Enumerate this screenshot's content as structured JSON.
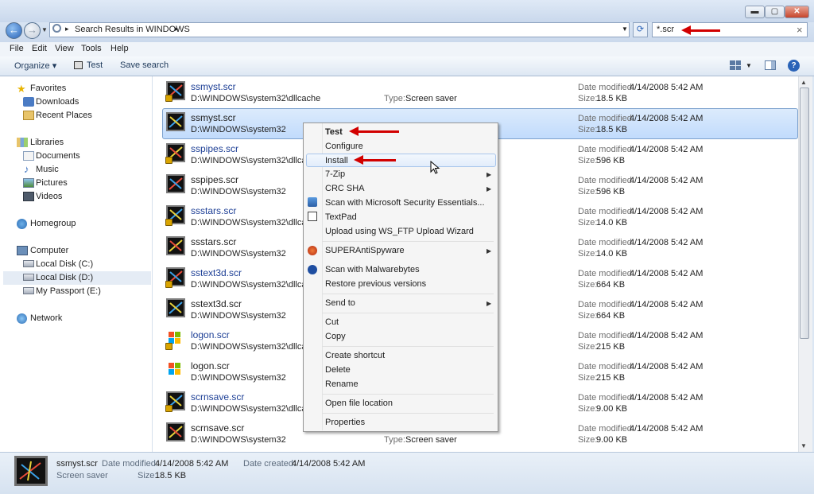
{
  "window": {
    "minimize": "▬",
    "maximize": "▢",
    "close": "✕"
  },
  "address": {
    "path_root": "▸",
    "search_results": "Search Results in WINDOWS",
    "path_sep": "▸"
  },
  "search": {
    "value": "*.scr",
    "clear": "×"
  },
  "menubar": {
    "file": "File",
    "edit": "Edit",
    "view": "View",
    "tools": "Tools",
    "help": "Help"
  },
  "toolbar": {
    "organize": "Organize ▾",
    "test": "Test",
    "save_search": "Save search"
  },
  "sidebar": {
    "favorites": "Favorites",
    "downloads": "Downloads",
    "recent_places": "Recent Places",
    "libraries": "Libraries",
    "documents": "Documents",
    "music": "Music",
    "pictures": "Pictures",
    "videos": "Videos",
    "homegroup": "Homegroup",
    "computer": "Computer",
    "local_c": "Local Disk (C:)",
    "local_d": "Local Disk (D:)",
    "passport": "My Passport (E:)",
    "network": "Network"
  },
  "labels": {
    "date_modified": "Date modified:",
    "size": "Size:",
    "type": "Type:"
  },
  "files": [
    {
      "name": "ssmyst.scr",
      "path": "D:\\WINDOWS\\system32\\dllcache",
      "date": "4/14/2008 5:42 AM",
      "size": "18.5 KB",
      "type": "Screen saver"
    },
    {
      "name": "ssmyst.scr",
      "path": "D:\\WINDOWS\\system32",
      "date": "4/14/2008 5:42 AM",
      "size": "18.5 KB"
    },
    {
      "name": "sspipes.scr",
      "path": "D:\\WINDOWS\\system32\\dllcache",
      "date": "4/14/2008 5:42 AM",
      "size": "596 KB"
    },
    {
      "name": "sspipes.scr",
      "path": "D:\\WINDOWS\\system32",
      "date": "4/14/2008 5:42 AM",
      "size": "596 KB"
    },
    {
      "name": "ssstars.scr",
      "path": "D:\\WINDOWS\\system32\\dllcache",
      "date": "4/14/2008 5:42 AM",
      "size": "14.0 KB"
    },
    {
      "name": "ssstars.scr",
      "path": "D:\\WINDOWS\\system32",
      "date": "4/14/2008 5:42 AM",
      "size": "14.0 KB"
    },
    {
      "name": "sstext3d.scr",
      "path": "D:\\WINDOWS\\system32\\dllcache",
      "date": "4/14/2008 5:42 AM",
      "size": "664 KB"
    },
    {
      "name": "sstext3d.scr",
      "path": "D:\\WINDOWS\\system32",
      "date": "4/14/2008 5:42 AM",
      "size": "664 KB"
    },
    {
      "name": "logon.scr",
      "path": "D:\\WINDOWS\\system32\\dllcache",
      "date": "4/14/2008 5:42 AM",
      "size": "215 KB"
    },
    {
      "name": "logon.scr",
      "path": "D:\\WINDOWS\\system32",
      "date": "4/14/2008 5:42 AM",
      "size": "215 KB"
    },
    {
      "name": "scrnsave.scr",
      "path": "D:\\WINDOWS\\system32\\dllcache",
      "date": "4/14/2008 5:42 AM",
      "size": "9.00 KB"
    },
    {
      "name": "scrnsave.scr",
      "path": "D:\\WINDOWS\\system32",
      "date": "4/14/2008 5:42 AM",
      "size": "9.00 KB",
      "type": "Screen saver"
    }
  ],
  "context_menu": {
    "test": "Test",
    "configure": "Configure",
    "install": "Install",
    "zip": "7-Zip",
    "crc": "CRC SHA",
    "scan_mse": "Scan with Microsoft Security Essentials...",
    "textpad": "TextPad",
    "upload": "Upload using WS_FTP Upload Wizard",
    "superanti": "SUPERAntiSpyware",
    "malwarebytes": "Scan with Malwarebytes",
    "restore": "Restore previous versions",
    "send_to": "Send to",
    "cut": "Cut",
    "copy": "Copy",
    "create_shortcut": "Create shortcut",
    "delete": "Delete",
    "rename": "Rename",
    "open_location": "Open file location",
    "properties": "Properties",
    "submenu_arrow": "▶"
  },
  "details": {
    "name": "ssmyst.scr",
    "type": "Screen saver",
    "date_modified_label": "Date modified:",
    "date_modified": "4/14/2008 5:42 AM",
    "date_created_label": "Date created:",
    "date_created": "4/14/2008 5:42 AM",
    "size_label": "Size:",
    "size": "18.5 KB"
  },
  "colors": {
    "annotation_arrow": "#d20000",
    "selection": "#c1dbfc",
    "link": "#1c3e95"
  }
}
